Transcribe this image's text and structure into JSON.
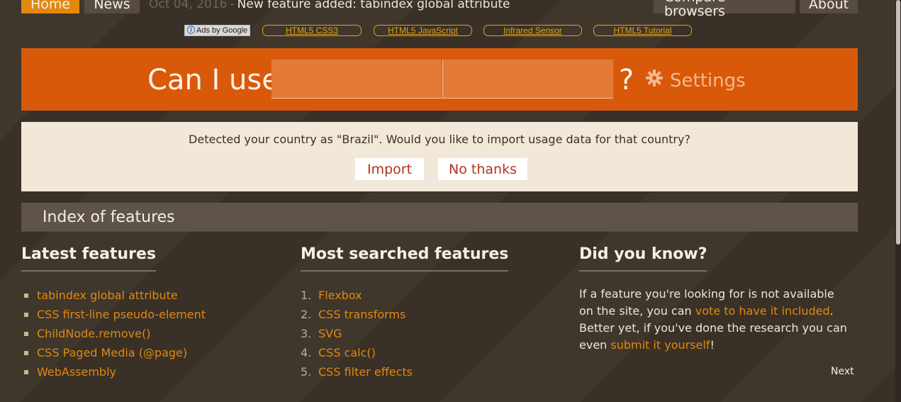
{
  "nav": {
    "home": "Home",
    "news": "News",
    "compare": "Compare browsers",
    "about": "About"
  },
  "news_ticker": {
    "date": "Oct 04, 2016",
    "separator": "-",
    "text": "New feature added: tabindex global attribute"
  },
  "ads": {
    "choice_label": "Ads by Google",
    "links": [
      "HTML5 CSS3",
      "HTML5 JavaScript",
      "Infrared Sensor",
      "HTML5 Tutorial"
    ]
  },
  "search": {
    "prefix": "Can I use",
    "suffix": "?",
    "field1_value": "",
    "field2_value": "",
    "settings_label": "Settings"
  },
  "country_prompt": {
    "message": "Detected your country as \"Brazil\". Would you like to import usage data for that country?",
    "import_label": "Import",
    "decline_label": "No thanks"
  },
  "index": {
    "title": "Index of features"
  },
  "latest": {
    "heading": "Latest features",
    "items": [
      "tabindex global attribute",
      "CSS first-line pseudo-element",
      "ChildNode.remove()",
      "CSS Paged Media (@page)",
      "WebAssembly"
    ]
  },
  "most_searched": {
    "heading": "Most searched features",
    "items": [
      {
        "n": "1.",
        "label": "Flexbox"
      },
      {
        "n": "2.",
        "label": "CSS transforms"
      },
      {
        "n": "3.",
        "label": "SVG"
      },
      {
        "n": "4.",
        "label": "CSS calc()"
      },
      {
        "n": "5.",
        "label": "CSS filter effects"
      }
    ]
  },
  "did_you_know": {
    "heading": "Did you know?",
    "text_1": "If a feature you're looking for is not available on the site, you can ",
    "link_1": "vote to have it included",
    "text_2": ". Better yet, if you've done the research you can even ",
    "link_2": "submit it yourself",
    "text_3": "!",
    "next_label": "Next"
  },
  "colors": {
    "accent": "#e2880d",
    "search_bar": "#d9590a",
    "panel": "#f2e8d9",
    "background": "#3b3228"
  }
}
